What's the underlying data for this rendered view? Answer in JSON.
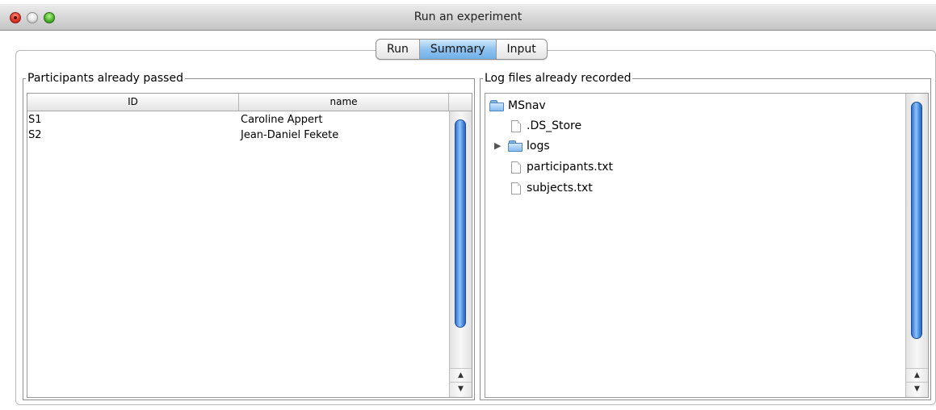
{
  "window": {
    "title": "Run an experiment"
  },
  "tabs": [
    {
      "label": "Run",
      "active": false
    },
    {
      "label": "Summary",
      "active": true
    },
    {
      "label": "Input",
      "active": false
    }
  ],
  "participants": {
    "title": "Participants already passed",
    "columns": [
      "ID",
      "name"
    ],
    "rows": [
      {
        "id": "S1",
        "name": "Caroline Appert"
      },
      {
        "id": "S2",
        "name": "Jean-Daniel Fekete"
      }
    ]
  },
  "logs": {
    "title": "Log files already recorded",
    "root": "MSnav",
    "children": [
      {
        "name": ".DS_Store",
        "type": "file"
      },
      {
        "name": "logs",
        "type": "folder",
        "expanded": false
      },
      {
        "name": "participants.txt",
        "type": "file"
      },
      {
        "name": "subjects.txt",
        "type": "file"
      }
    ]
  },
  "icons": {
    "close": "close-icon",
    "minimize": "minimize-icon",
    "zoom": "zoom-icon",
    "folder": "folder-icon",
    "file": "file-icon",
    "disclosure": "disclosure-triangle-icon"
  },
  "colors": {
    "selected_tab": "#8fc3ee",
    "scroll_thumb": "#4b8ee0",
    "folder": "#87bdf0"
  }
}
